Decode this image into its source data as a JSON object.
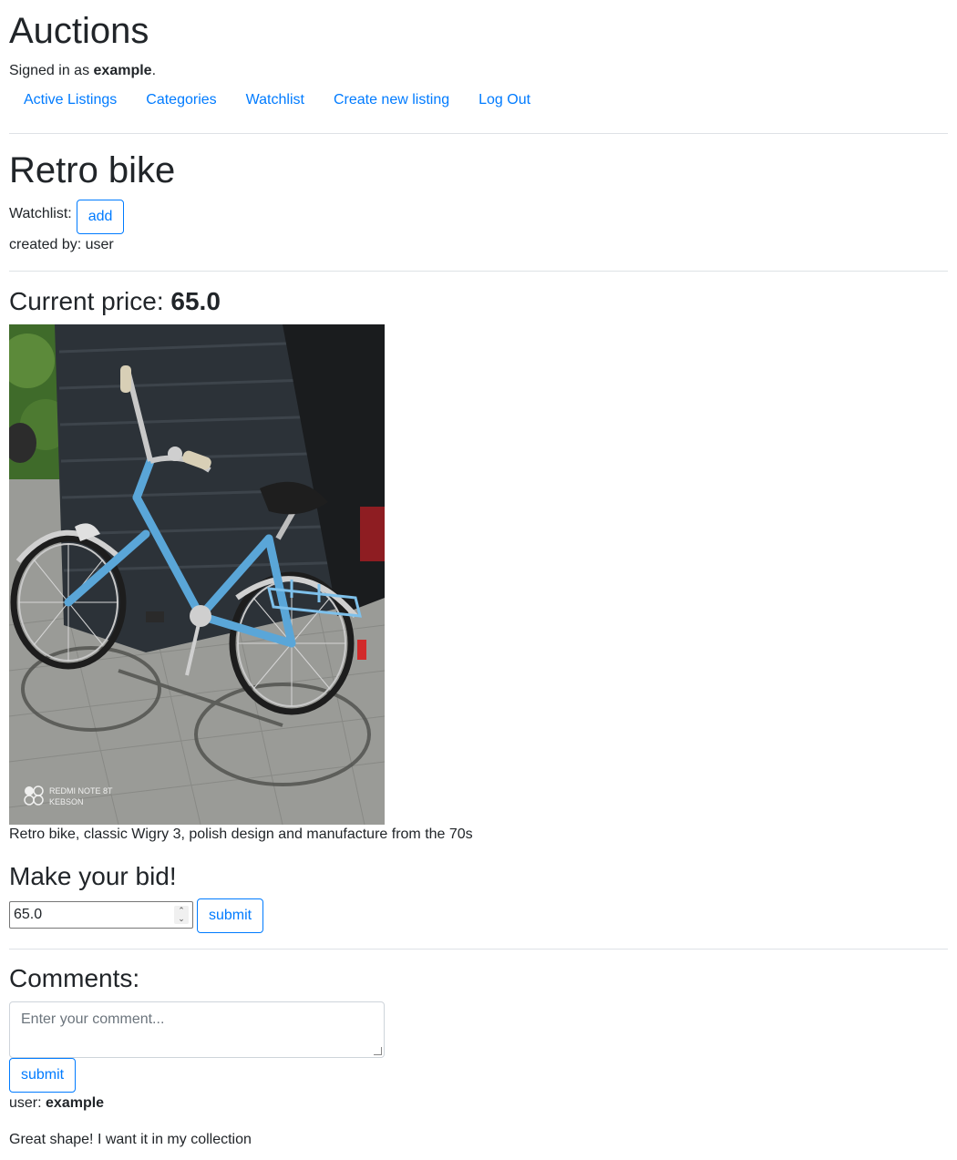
{
  "site": {
    "title": "Auctions",
    "signed_in_prefix": "Signed in as",
    "username": "example",
    "signed_in_suffix": "."
  },
  "nav": {
    "active_listings": "Active Listings",
    "categories": "Categories",
    "watchlist": "Watchlist",
    "create_listing": "Create new listing",
    "logout": "Log Out"
  },
  "listing": {
    "title": "Retro bike",
    "watchlist_label": "Watchlist:",
    "watchlist_button": "add",
    "created_by": "created by: user",
    "price_label": "Current price:",
    "price_value": "65.0",
    "image_watermark_line1": "REDMI NOTE 8T",
    "image_watermark_line2": "KEBSON",
    "description": "Retro bike, classic Wigry 3, polish design and manufacture from the 70s"
  },
  "bid": {
    "heading": "Make your bid!",
    "value": "65.0",
    "submit_label": "submit"
  },
  "comments": {
    "heading": "Comments:",
    "placeholder": "Enter your comment...",
    "submit_label": "submit",
    "items": [
      {
        "user_prefix": "user:",
        "user": "example",
        "text": "Great shape! I want it in my collection"
      }
    ]
  },
  "colors": {
    "link": "#007bff",
    "text": "#212529",
    "divider": "#dee2e6",
    "bike_frame": "#5aa6d8"
  }
}
